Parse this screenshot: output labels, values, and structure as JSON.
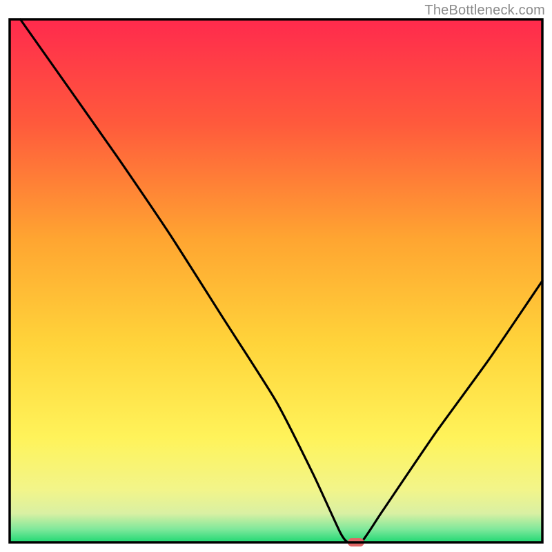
{
  "watermark": "TheBottleneck.com",
  "chart_data": {
    "type": "line",
    "title": "",
    "xlabel": "",
    "ylabel": "",
    "xlim": [
      0,
      100
    ],
    "ylim": [
      0,
      100
    ],
    "note": "Bottleneck curve: y is approximate bottleneck percentage (0 = no bottleneck at green baseline, 100 = top of plot). The optimal point is the flat minimum region near x ≈ 63-66 where the curve touches the green band at y ≈ 0.",
    "curve": [
      {
        "x": 2,
        "y": 100
      },
      {
        "x": 20,
        "y": 74
      },
      {
        "x": 30,
        "y": 59
      },
      {
        "x": 40,
        "y": 43
      },
      {
        "x": 50,
        "y": 27
      },
      {
        "x": 57,
        "y": 13
      },
      {
        "x": 62,
        "y": 2
      },
      {
        "x": 63.5,
        "y": 0
      },
      {
        "x": 66,
        "y": 0
      },
      {
        "x": 70,
        "y": 6
      },
      {
        "x": 80,
        "y": 21
      },
      {
        "x": 90,
        "y": 35
      },
      {
        "x": 100,
        "y": 50
      }
    ],
    "marker": {
      "x": 65,
      "y": 0,
      "color": "#e06666"
    },
    "gradient_stops": [
      {
        "offset": 0.0,
        "color": "#ff2a4d"
      },
      {
        "offset": 0.2,
        "color": "#ff5a3c"
      },
      {
        "offset": 0.42,
        "color": "#ffa531"
      },
      {
        "offset": 0.62,
        "color": "#ffd43a"
      },
      {
        "offset": 0.8,
        "color": "#fff35a"
      },
      {
        "offset": 0.9,
        "color": "#f2f58a"
      },
      {
        "offset": 0.945,
        "color": "#d9f0a3"
      },
      {
        "offset": 0.975,
        "color": "#7fe89b"
      },
      {
        "offset": 1.0,
        "color": "#1fd873"
      }
    ],
    "axes": {
      "color": "#000000",
      "width": 3.5
    }
  }
}
